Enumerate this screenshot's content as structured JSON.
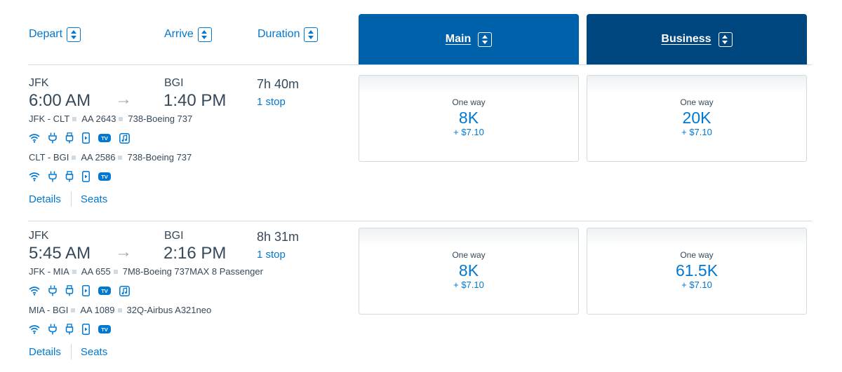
{
  "columns": {
    "depart": "Depart",
    "arrive": "Arrive",
    "duration": "Duration"
  },
  "cabins": {
    "main": {
      "label": "Main",
      "color": "#0061ab"
    },
    "business": {
      "label": "Business",
      "color": "#00467f"
    }
  },
  "colors": {
    "link": "#0078d2",
    "text": "#36495a",
    "divider": "#d0dae0"
  },
  "flights": [
    {
      "origin": "JFK",
      "destination": "BGI",
      "depart_time": "6:00 AM",
      "arrive_time": "1:40 PM",
      "duration": "7h 40m",
      "stops": "1 stop",
      "segments": [
        {
          "route": "JFK - CLT",
          "flight": "AA 2643",
          "aircraft": "738-Boeing 737",
          "amenities": [
            "wifi-icon",
            "power-outlet-icon",
            "usb-icon",
            "device-entertainment-icon",
            "tv-icon",
            "music-icon"
          ]
        },
        {
          "route": "CLT - BGI",
          "flight": "AA 2586",
          "aircraft": "738-Boeing 737",
          "amenities": [
            "wifi-icon",
            "power-outlet-icon",
            "usb-icon",
            "device-entertainment-icon",
            "tv-icon"
          ]
        }
      ],
      "links": {
        "details": "Details",
        "seats": "Seats"
      },
      "fares": {
        "main": {
          "label": "One way",
          "miles": "8K",
          "tax": "+ $7.10"
        },
        "business": {
          "label": "One way",
          "miles": "20K",
          "tax": "+ $7.10"
        }
      }
    },
    {
      "origin": "JFK",
      "destination": "BGI",
      "depart_time": "5:45 AM",
      "arrive_time": "2:16 PM",
      "duration": "8h 31m",
      "stops": "1 stop",
      "segments": [
        {
          "route": "JFK - MIA",
          "flight": "AA 655",
          "aircraft": "7M8-Boeing 737MAX 8 Passenger",
          "amenities": [
            "wifi-icon",
            "power-outlet-icon",
            "usb-icon",
            "device-entertainment-icon",
            "tv-icon",
            "music-icon"
          ]
        },
        {
          "route": "MIA - BGI",
          "flight": "AA 1089",
          "aircraft": "32Q-Airbus A321neo",
          "amenities": [
            "wifi-icon",
            "power-outlet-icon",
            "usb-icon",
            "device-entertainment-icon",
            "tv-icon"
          ]
        }
      ],
      "links": {
        "details": "Details",
        "seats": "Seats"
      },
      "fares": {
        "main": {
          "label": "One way",
          "miles": "8K",
          "tax": "+ $7.10"
        },
        "business": {
          "label": "One way",
          "miles": "61.5K",
          "tax": "+ $7.10"
        }
      }
    }
  ]
}
